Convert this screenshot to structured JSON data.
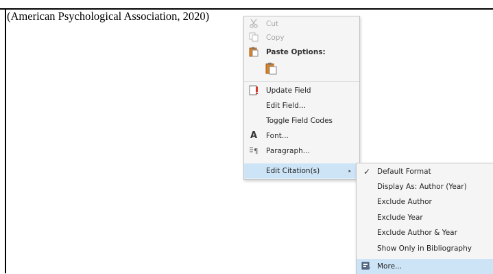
{
  "document": {
    "citation_text": "(American Psychological Association, 2020)"
  },
  "context_menu": {
    "cut": {
      "label": "Cut",
      "icon": "scissors-icon",
      "enabled": false
    },
    "copy": {
      "label": "Copy",
      "icon": "copy-icon",
      "enabled": false
    },
    "paste_options": {
      "label": "Paste Options:",
      "icon": "clipboard-icon"
    },
    "paste_keep_text": {
      "icon": "clipboard-paste-icon"
    },
    "update_field": {
      "label": "Update Field",
      "icon": "update-field-icon"
    },
    "edit_field": {
      "label": "Edit Field..."
    },
    "toggle_field_codes": {
      "label": "Toggle Field Codes"
    },
    "font": {
      "label": "Font...",
      "icon": "font-icon"
    },
    "paragraph": {
      "label": "Paragraph...",
      "icon": "paragraph-icon"
    },
    "edit_citations": {
      "label": "Edit Citation(s)",
      "highlighted": true
    }
  },
  "submenu": {
    "default_format": {
      "label": "Default Format",
      "checked": true
    },
    "display_as": {
      "label": "Display As: Author (Year)"
    },
    "exclude_author": {
      "label": "Exclude Author"
    },
    "exclude_year": {
      "label": "Exclude Year"
    },
    "exclude_author_year": {
      "label": "Exclude Author & Year"
    },
    "show_only_bibliography": {
      "label": "Show Only in Bibliography"
    },
    "more": {
      "label": "More...",
      "icon": "more-icon",
      "highlighted": true
    }
  },
  "colors": {
    "menu_bg": "#f5f5f5",
    "highlight": "#cde4f7",
    "disabled_text": "#a8a8a8"
  }
}
